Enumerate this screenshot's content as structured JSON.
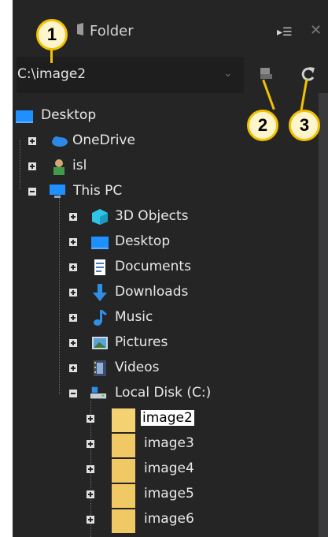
{
  "panel": {
    "title": "Folder",
    "path_value": "C:\\image2",
    "icons": [
      "folder-icon",
      "pin-panel-icon",
      "close-icon",
      "chevron-down-icon",
      "new-folder-icon",
      "refresh-icon"
    ]
  },
  "tree": {
    "desktop": "Desktop",
    "onedrive": "OneDrive",
    "user": "isl",
    "thispc": "This PC",
    "objects3d": "3D Objects",
    "desktop2": "Desktop",
    "documents": "Documents",
    "downloads": "Downloads",
    "music": "Music",
    "pictures": "Pictures",
    "videos": "Videos",
    "localdisk": "Local Disk (C:)",
    "folders": [
      "image2",
      "image3",
      "image4",
      "image5",
      "image6"
    ],
    "selected": "image2"
  },
  "callouts": [
    "1",
    "2",
    "3"
  ],
  "colors": {
    "panel_bg": "#252526",
    "badge_border": "#f2c100",
    "badge_fill": "#fff5cc"
  }
}
